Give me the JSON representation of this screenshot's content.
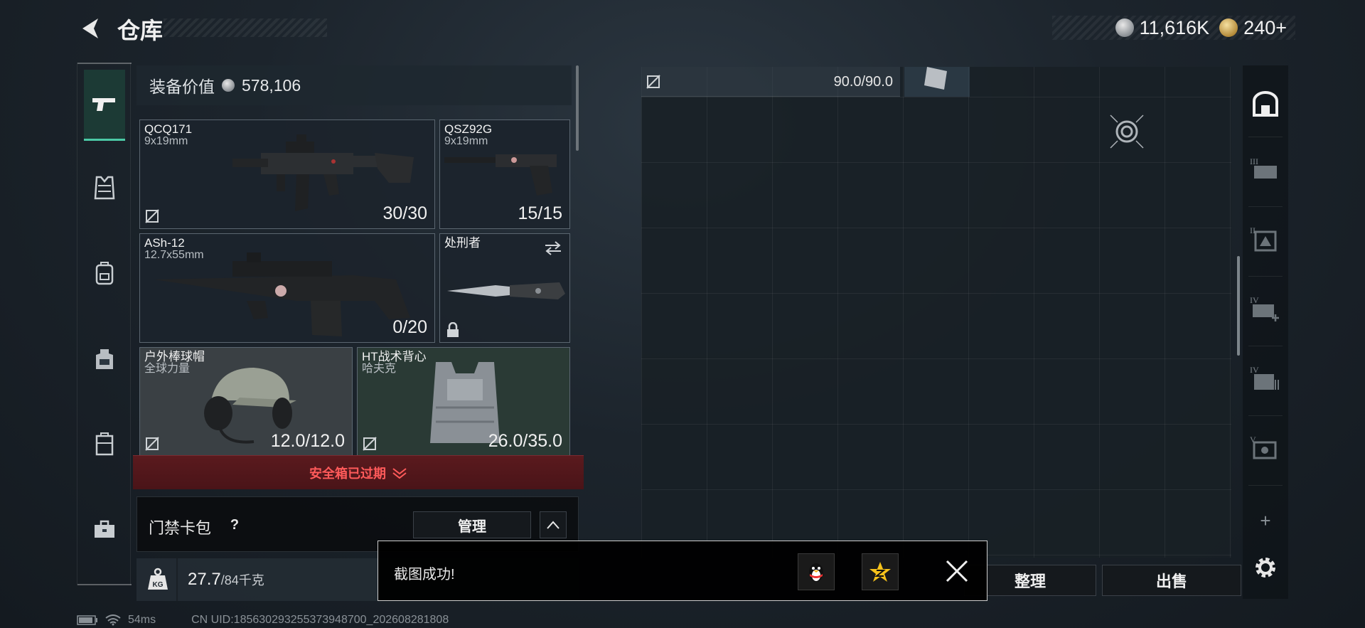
{
  "header": {
    "title": "仓库",
    "currencies": [
      {
        "icon": "silver-coin-icon",
        "value": "11,616K"
      },
      {
        "icon": "gold-coin-icon",
        "value": "240+"
      }
    ]
  },
  "left_nav": {
    "items": [
      {
        "name": "weapons",
        "icon": "pistol-icon",
        "active": true
      },
      {
        "name": "armor",
        "icon": "vest-icon",
        "active": false
      },
      {
        "name": "backpack",
        "icon": "backpack-icon",
        "active": false
      },
      {
        "name": "chest-rig",
        "icon": "rig-icon",
        "active": false
      },
      {
        "name": "container",
        "icon": "case-icon",
        "active": false
      },
      {
        "name": "toolbox",
        "icon": "briefcase-icon",
        "active": false
      }
    ]
  },
  "loadout": {
    "value_label": "装备价值",
    "value": "578,106",
    "slots": [
      {
        "name": "QCQ171",
        "sub": "9x19mm",
        "count": "30/30"
      },
      {
        "name": "QSZ92G",
        "sub": "9x19mm",
        "count": "15/15"
      },
      {
        "name": "ASh-12",
        "sub": "12.7x55mm",
        "count": "0/20"
      },
      {
        "name": "处刑者",
        "sub": "",
        "count": ""
      },
      {
        "name": "户外棒球帽",
        "sub": "全球力量",
        "count": "12.0/12.0"
      },
      {
        "name": "HT战术背心",
        "sub": "哈夫克",
        "count": "26.0/35.0"
      }
    ],
    "safe_box_text": "安全箱已过期",
    "card_pack_label": "门禁卡包",
    "card_pack_help": "?",
    "manage_label": "管理",
    "weight_value": "27.7",
    "weight_max": "/84千克"
  },
  "storage": {
    "first_item_durability": "90.0/90.0",
    "sort_label": "整理",
    "sell_label": "出售"
  },
  "right_nav": {
    "items": [
      "house-icon",
      "crate-iii-icon",
      "crate-ii-icon",
      "medkit-iv-icon",
      "ammo-iv-icon",
      "case-v-icon"
    ],
    "add_label": "+"
  },
  "toast": {
    "message": "截图成功!"
  },
  "status": {
    "ping": "54ms",
    "uid": "CN UID:1856302932553739487​00_202608281808"
  },
  "colors": {
    "accent": "#4cc9a6",
    "warning": "#ff5a5a"
  }
}
